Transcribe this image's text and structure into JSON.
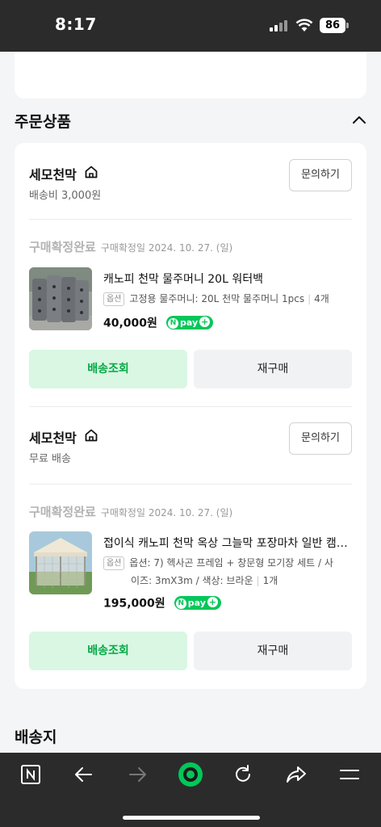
{
  "status_bar": {
    "time": "8:17",
    "battery": "86"
  },
  "section": {
    "title": "주문상품"
  },
  "orders": [
    {
      "seller": "세모천막",
      "shipping": "배송비 3,000원",
      "inquiry_label": "문의하기",
      "status": "구매확정완료",
      "status_date": "구매확정일 2024. 10. 27. (일)",
      "product_title": "캐노피 천막 물주머니 20L 워터백",
      "option_badge": "옵션",
      "option_text": "고정용 물주머니: 20L 천막 물주머니 1pcs",
      "quantity": "4개",
      "price": "40,000원",
      "track_label": "배송조회",
      "rebuy_label": "재구매"
    },
    {
      "seller": "세모천막",
      "shipping": "무료 배송",
      "inquiry_label": "문의하기",
      "status": "구매확정완료",
      "status_date": "구매확정일 2024. 10. 27. (일)",
      "product_title": "접이식 캐노피 천막 옥상 그늘막 포장마차 일반 캠핑 천막",
      "option_badge": "옵션",
      "option_text_line1": "옵션: 7) 헥사곤 프레임 + 창문형 모기장 세트 / 사",
      "option_text_line2": "이즈: 3mX3m / 색상: 브라운",
      "quantity": "1개",
      "price": "195,000원",
      "track_label": "배송조회",
      "rebuy_label": "재구매"
    }
  ],
  "npay": {
    "n": "N",
    "label": "pay",
    "plus": "+"
  },
  "shipping_section": {
    "title": "배송지"
  },
  "colors": {
    "accent": "#03c75a",
    "track_bg": "#d9f7e3",
    "dark_bar": "#2b2b2b"
  }
}
